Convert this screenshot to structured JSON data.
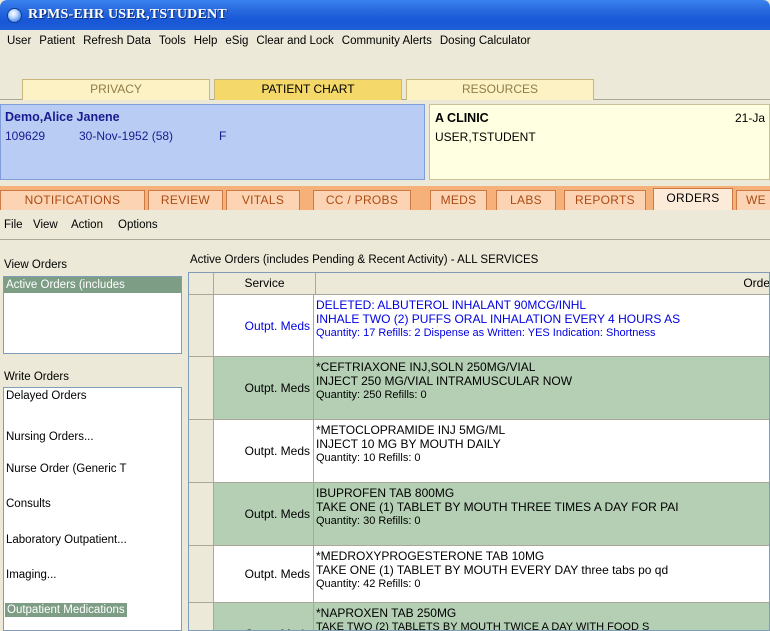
{
  "window": {
    "title": "RPMS-EHR USER,TSTUDENT"
  },
  "menu": [
    "User",
    "Patient",
    "Refresh Data",
    "Tools",
    "Help",
    "eSig",
    "Clear and Lock",
    "Community Alerts",
    "Dosing Calculator"
  ],
  "main_tabs": [
    "PRIVACY",
    "PATIENT CHART",
    "RESOURCES"
  ],
  "patient": {
    "name": "Demo,Alice Janene",
    "id": "109629",
    "dob": "30-Nov-1952 (58)",
    "sex": "F"
  },
  "clinic": {
    "name": "A CLINIC",
    "date": "21-Ja",
    "user": "USER,TSTUDENT"
  },
  "chart_tabs": [
    "NOTIFICATIONS",
    "REVIEW",
    "VITALS",
    "CC / PROBS",
    "MEDS",
    "LABS",
    "REPORTS",
    "ORDERS",
    "WE"
  ],
  "sub_menu": [
    "File",
    "View",
    "Action",
    "Options"
  ],
  "view_orders": {
    "label": "View Orders",
    "selected": "Active Orders (includes"
  },
  "write_orders": {
    "label": "Write Orders",
    "items": [
      "Delayed Orders",
      "Nursing Orders...",
      "Nurse Order (Generic T",
      "Consults",
      "Laboratory Outpatient...",
      "Imaging...",
      "Outpatient Medications"
    ]
  },
  "orders": {
    "title": "Active Orders (includes Pending & Recent Activity) - ALL SERVICES",
    "columns": [
      "Service",
      "Order"
    ],
    "rows": [
      {
        "service": "Outpt. Meds",
        "lines": [
          "DELETED: ALBUTEROL INHALANT  90MCG/INHL",
          "INHALE TWO (2) PUFFS ORAL INHALATION EVERY 4 HOURS AS",
          "Quantity: 17 Refills: 2 Dispense as Written: YES Indication: Shortness"
        ]
      },
      {
        "service": "Outpt. Meds",
        "lines": [
          "*CEFTRIAXONE INJ,SOLN  250MG/VIAL",
          "INJECT 250 MG/VIAL INTRAMUSCULAR NOW",
          "Quantity: 250 Refills: 0"
        ]
      },
      {
        "service": "Outpt. Meds",
        "lines": [
          "*METOCLOPRAMIDE INJ  5MG/ML",
          "INJECT 10 MG BY MOUTH DAILY",
          "Quantity: 10 Refills: 0"
        ]
      },
      {
        "service": "Outpt. Meds",
        "lines": [
          "IBUPROFEN TAB  800MG",
          "TAKE ONE (1) TABLET BY MOUTH THREE TIMES A DAY FOR PAI",
          "Quantity: 30 Refills: 0"
        ]
      },
      {
        "service": "Outpt. Meds",
        "lines": [
          "*MEDROXYPROGESTERONE TAB  10MG",
          "TAKE ONE (1) TABLET BY MOUTH EVERY DAY three tabs po qd",
          "Quantity: 42 Refills: 0"
        ]
      },
      {
        "service": "Outpt. Meds",
        "lines": [
          "*NAPROXEN TAB  250MG",
          "TAKE TWO (2) TABLETS BY MOUTH TWICE A DAY WITH FOOD S"
        ]
      }
    ]
  },
  "colors": {
    "selection_green": "#7d9d85",
    "row_green": "#b4cfb4",
    "deleted_blue": "#0000e0"
  }
}
